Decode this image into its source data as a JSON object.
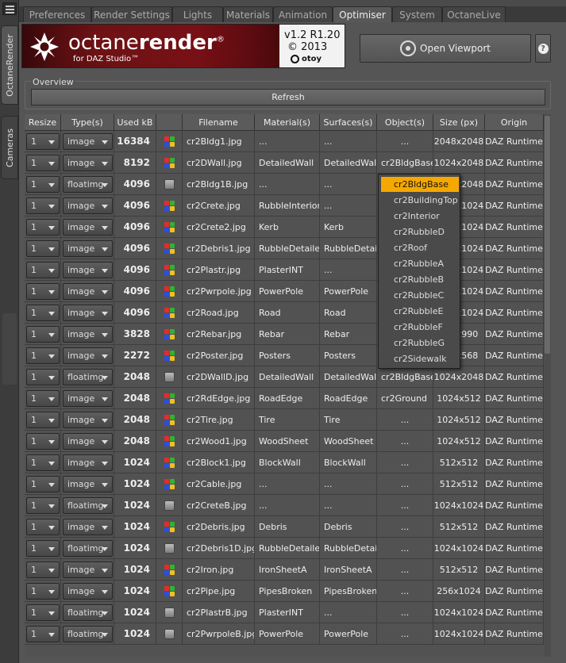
{
  "tabs": [
    "Preferences",
    "Render Settings",
    "Lights",
    "Materials",
    "Animation",
    "Optimiser",
    "System",
    "OctaneLive"
  ],
  "active_tab": "Optimiser",
  "side_tabs": [
    "OctaneRender",
    "Cameras"
  ],
  "logo": {
    "title_light": "octane",
    "title_bold": "render",
    "registered": "®",
    "subtitle": "for DAZ Studio™",
    "version": "v1.2 R1.20",
    "year": "© 2013",
    "brand": "otoy"
  },
  "open_viewport_label": "Open Viewport",
  "help_label": "?",
  "overview_label": "Overview",
  "refresh_label": "Refresh",
  "columns": [
    "Resize",
    "Type(s)",
    "Used kB",
    "",
    "Filename",
    "Material(s)",
    "Surfaces(s)",
    "Object(s)",
    "Size (px)",
    "Origin"
  ],
  "rows": [
    [
      "1",
      "image",
      "16384",
      "rgb",
      "cr2Bldg1.jpg",
      "...",
      "...",
      "...",
      "2048x2048",
      "DAZ Runtime"
    ],
    [
      "1",
      "image",
      "8192",
      "rgb",
      "cr2DWall.jpg",
      "DetailedWall",
      "DetailedWall",
      "cr2BldgBase",
      "1024x2048",
      "DAZ Runtime"
    ],
    [
      "1",
      "floatimg",
      "4096",
      "gray",
      "cr2Bldg1B.jpg",
      "...",
      "...",
      "...",
      "2048x2048",
      "DAZ Runtime"
    ],
    [
      "1",
      "image",
      "4096",
      "rgb",
      "cr2Crete.jpg",
      "RubbleInterior",
      "...",
      "...",
      "1024x1024",
      "DAZ Runtime"
    ],
    [
      "1",
      "image",
      "4096",
      "rgb",
      "cr2Crete2.jpg",
      "Kerb",
      "Kerb",
      "...",
      "1024x1024",
      "DAZ Runtime"
    ],
    [
      "1",
      "image",
      "4096",
      "rgb",
      "cr2Debris1.jpg",
      "RubbleDetailed",
      "RubbleDetailed",
      "...",
      "1024x1024",
      "DAZ Runtime"
    ],
    [
      "1",
      "image",
      "4096",
      "rgb",
      "cr2Plastr.jpg",
      "PlasterINT",
      "...",
      "...",
      "1024x1024",
      "DAZ Runtime"
    ],
    [
      "1",
      "image",
      "4096",
      "rgb",
      "cr2Pwrpole.jpg",
      "PowerPole",
      "PowerPole",
      "...",
      "1024x1024",
      "DAZ Runtime"
    ],
    [
      "1",
      "image",
      "4096",
      "rgb",
      "cr2Road.jpg",
      "Road",
      "Road",
      "...",
      "1024x1024",
      "DAZ Runtime"
    ],
    [
      "1",
      "image",
      "3828",
      "rgb",
      "cr2Rebar.jpg",
      "Rebar",
      "Rebar",
      "...",
      "990x990",
      "DAZ Runtime"
    ],
    [
      "1",
      "image",
      "2272",
      "rgb",
      "cr2Poster.jpg",
      "Posters",
      "Posters",
      "...",
      "568x568",
      "DAZ Runtime"
    ],
    [
      "1",
      "floatimg",
      "2048",
      "gray",
      "cr2DWallD.jpg",
      "DetailedWall",
      "DetailedWall",
      "cr2BldgBase",
      "1024x2048",
      "DAZ Runtime"
    ],
    [
      "1",
      "image",
      "2048",
      "rgb",
      "cr2RdEdge.jpg",
      "RoadEdge",
      "RoadEdge",
      "cr2Ground",
      "1024x512",
      "DAZ Runtime"
    ],
    [
      "1",
      "image",
      "2048",
      "rgb",
      "cr2Tire.jpg",
      "Tire",
      "Tire",
      "...",
      "1024x512",
      "DAZ Runtime"
    ],
    [
      "1",
      "image",
      "2048",
      "rgb",
      "cr2Wood1.jpg",
      "WoodSheet",
      "WoodSheet",
      "...",
      "1024x512",
      "DAZ Runtime"
    ],
    [
      "1",
      "image",
      "1024",
      "rgb",
      "cr2Block1.jpg",
      "BlockWall",
      "BlockWall",
      "...",
      "512x512",
      "DAZ Runtime"
    ],
    [
      "1",
      "image",
      "1024",
      "rgb",
      "cr2Cable.jpg",
      "...",
      "...",
      "...",
      "512x512",
      "DAZ Runtime"
    ],
    [
      "1",
      "floatimg",
      "1024",
      "gray",
      "cr2CreteB.jpg",
      "...",
      "...",
      "...",
      "1024x1024",
      "DAZ Runtime"
    ],
    [
      "1",
      "image",
      "1024",
      "rgb",
      "cr2Debris.jpg",
      "Debris",
      "Debris",
      "...",
      "512x512",
      "DAZ Runtime"
    ],
    [
      "1",
      "floatimg",
      "1024",
      "gray",
      "cr2Debris1D.jpg",
      "RubbleDetailed",
      "RubbleDetailed",
      "...",
      "1024x1024",
      "DAZ Runtime"
    ],
    [
      "1",
      "image",
      "1024",
      "rgb",
      "cr2Iron.jpg",
      "IronSheetA",
      "IronSheetA",
      "...",
      "512x512",
      "DAZ Runtime"
    ],
    [
      "1",
      "image",
      "1024",
      "rgb",
      "cr2Pipe.jpg",
      "PipesBroken",
      "PipesBroken",
      "...",
      "256x1024",
      "DAZ Runtime"
    ],
    [
      "1",
      "floatimg",
      "1024",
      "gray",
      "cr2PlastrB.jpg",
      "PlasterINT",
      "...",
      "...",
      "1024x1024",
      "DAZ Runtime"
    ],
    [
      "1",
      "floatimg",
      "1024",
      "gray",
      "cr2PwrpoleB.jpg",
      "PowerPole",
      "PowerPole",
      "...",
      "1024x1024",
      "DAZ Runtime"
    ]
  ],
  "object_dropdown": {
    "selected": "cr2BldgBase",
    "items": [
      "cr2BldgBase",
      "cr2BuildingTop",
      "cr2Interior",
      "cr2RubbleD",
      "cr2Roof",
      "cr2RubbleA",
      "cr2RubbleB",
      "cr2RubbleC",
      "cr2RubbleE",
      "cr2RubbleF",
      "cr2RubbleG",
      "cr2Sidewalk"
    ]
  },
  "colors": {
    "dropdown_highlight": "#f5a800",
    "panel_bg": "#555555",
    "logo_red": "#7a1016"
  }
}
